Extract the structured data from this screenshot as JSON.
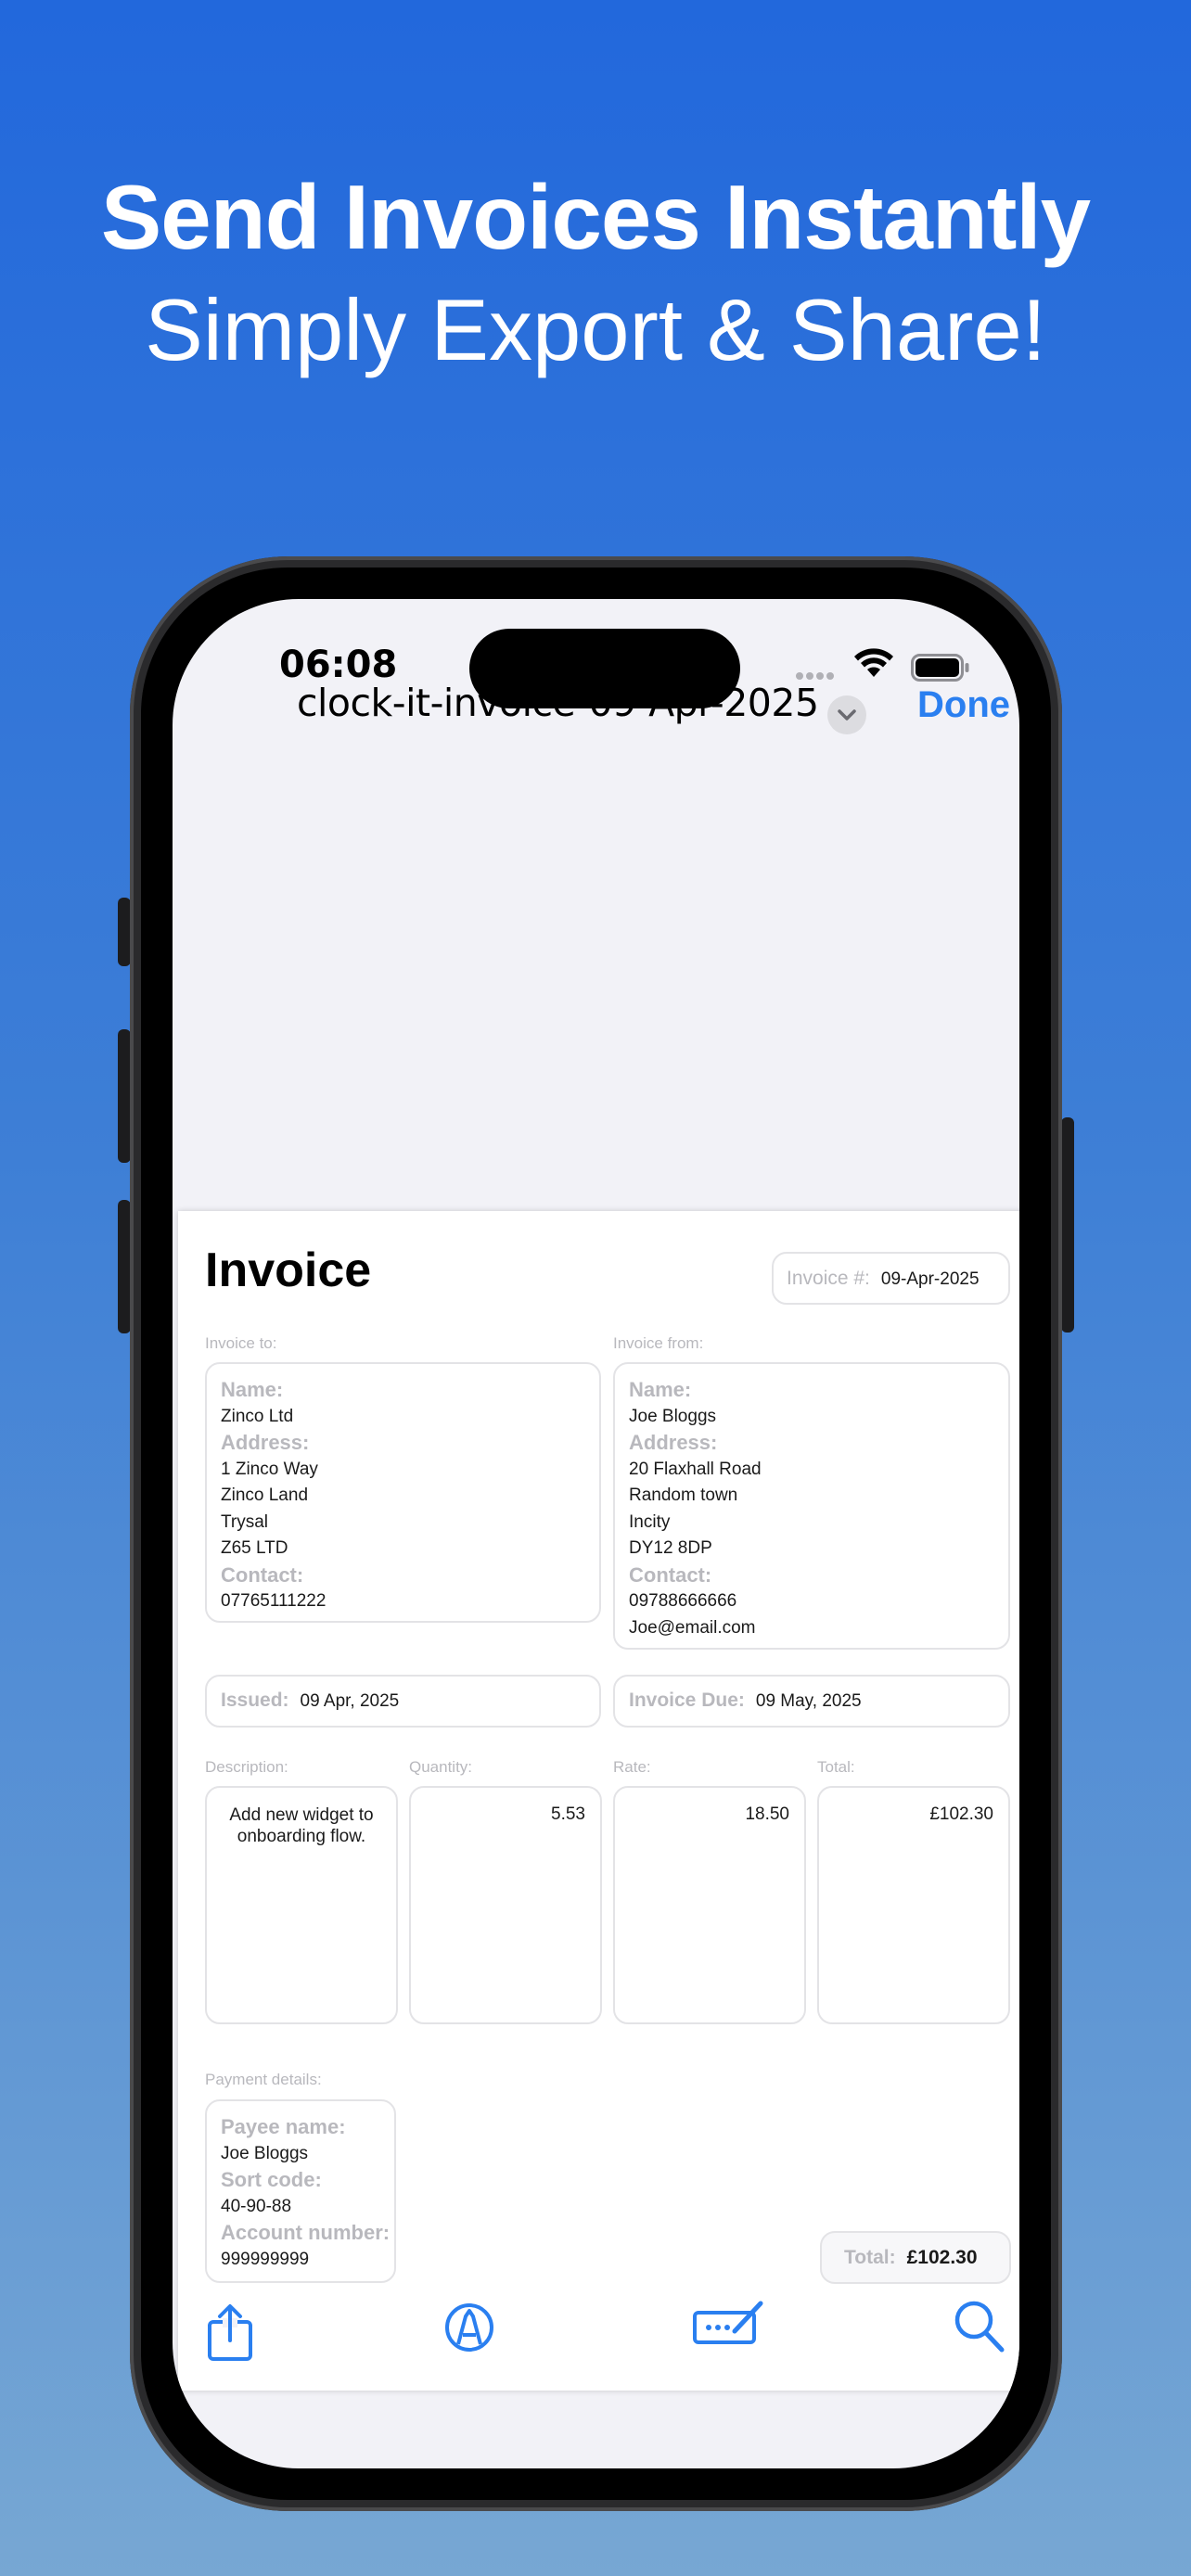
{
  "promo": {
    "headline": "Send Invoices Instantly",
    "subheadline": "Simply Export & Share!"
  },
  "status_bar": {
    "time": "06:08"
  },
  "nav": {
    "file_title": "clock-it-invoice-09-Apr-2025",
    "done_label": "Done"
  },
  "invoice": {
    "title": "Invoice",
    "number_label": "Invoice #:",
    "number_value": "09-Apr-2025",
    "to": {
      "section_label": "Invoice to:",
      "name_label": "Name:",
      "name": "Zinco Ltd",
      "address_label": "Address:",
      "address_lines": [
        "1 Zinco Way",
        "Zinco Land",
        "Trysal",
        "Z65 LTD"
      ],
      "contact_label": "Contact:",
      "contact_lines": [
        "07765111222"
      ]
    },
    "from": {
      "section_label": "Invoice from:",
      "name_label": "Name:",
      "name": "Joe Bloggs",
      "address_label": "Address:",
      "address_lines": [
        "20 Flaxhall Road",
        "Random town",
        "Incity",
        "DY12 8DP"
      ],
      "contact_label": "Contact:",
      "contact_lines": [
        "09788666666",
        "Joe@email.com"
      ]
    },
    "issued_label": "Issued:",
    "issued_value": "09 Apr, 2025",
    "due_label": "Invoice Due:",
    "due_value": "09 May, 2025",
    "columns": {
      "description": "Description:",
      "quantity": "Quantity:",
      "rate": "Rate:",
      "total": "Total:"
    },
    "line_item": {
      "description": "Add new widget to onboarding flow.",
      "quantity": "5.53",
      "rate": "18.50",
      "total": "£102.30"
    },
    "payment": {
      "section_label": "Payment details:",
      "payee_label": "Payee name:",
      "payee": "Joe Bloggs",
      "sort_label": "Sort code:",
      "sort_code": "40-90-88",
      "account_label": "Account number:",
      "account_number": "999999999"
    },
    "grand_total_label": "Total:",
    "grand_total_value": "£102.30"
  },
  "toolbar": {
    "icons": [
      "share-icon",
      "markup-icon",
      "signature-icon",
      "search-icon"
    ]
  },
  "colors": {
    "accent": "#2a7ff0",
    "background_top": "#2268dc",
    "background_bottom": "#77a7d3"
  }
}
